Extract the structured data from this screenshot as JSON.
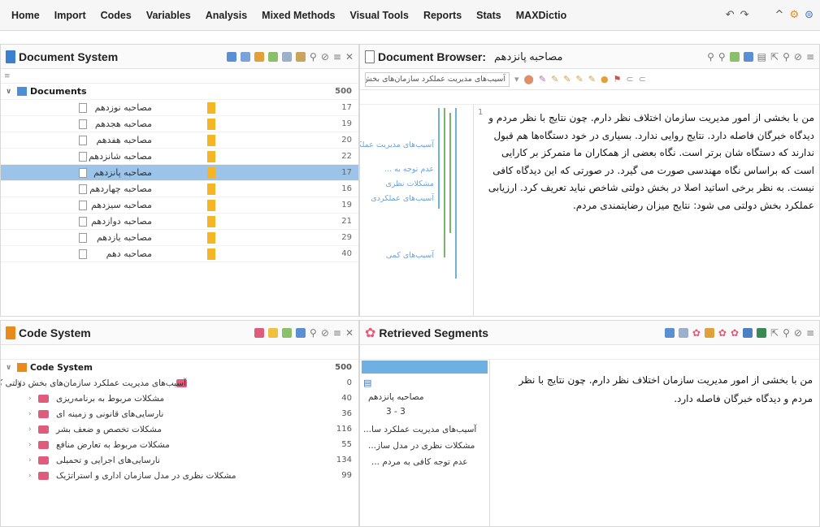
{
  "menu": [
    "Home",
    "Import",
    "Codes",
    "Variables",
    "Analysis",
    "Mixed Methods",
    "Visual Tools",
    "Reports",
    "Stats",
    "MAXDictio"
  ],
  "document_system": {
    "title": "Document System",
    "root": {
      "label": "Documents",
      "count": "500"
    },
    "documents": [
      {
        "name": "مصاحبه نوزدهم",
        "count": "17"
      },
      {
        "name": "مصاحبه هجدهم",
        "count": "19"
      },
      {
        "name": "مصاحبه هفدهم",
        "count": "20"
      },
      {
        "name": "مصاحبه شانزدهم",
        "count": "22"
      },
      {
        "name": "مصاحبه پانزدهم",
        "count": "17",
        "selected": true
      },
      {
        "name": "مصاحبه چهاردهم",
        "count": "16"
      },
      {
        "name": "مصاحبه سیزدهم",
        "count": "19"
      },
      {
        "name": "مصاحبه دوازدهم",
        "count": "21"
      },
      {
        "name": "مصاحبه یازدهم",
        "count": "29"
      },
      {
        "name": "مصاحبه دهم",
        "count": "40"
      }
    ]
  },
  "document_browser": {
    "title": "Document Browser:",
    "doc_name": "مصاحبه پانزدهم",
    "combo_value": "آسیب‌های مدیریت عملکرد سازمان‌های بخش دولتی کشور",
    "paragraph_number": "1",
    "strip_labels": [
      "آسیب‌های مدیریت عملکرد",
      "عدم توجه به ...",
      "مشکلات نظری",
      "آسیب‌های عملکردی",
      "آسیب‌های کمی"
    ],
    "text": "من با بخشی از امور مدیریت سازمان اختلاف نظر دارم. چون نتایج با نظر مردم و دیدگاه خبرگان فاصله دارد. نتایج روایی ندارد. بسیاری در خود دستگاه‌ها هم قبول ندارند که دستگاه شان برتر است. نگاه بعضی از همکاران ما متمرکز بر کارایی است که براساس نگاه مهندسی صورت می گیرد. در صورتی که این دیدگاه کافی نیست. به نظر برخی اساتید اصلا در بخش دولتی شاخص نباید تعریف کرد. ارزیابی عملکرد بخش دولتی می شود: نتایج میزان رضایتمندی مردم."
  },
  "code_system": {
    "title": "Code System",
    "root": {
      "label": "Code System",
      "count": "500"
    },
    "codes": [
      {
        "name": "آسیب‌های مدیریت عملکرد سازمان‌های بخش دولتی کشور",
        "count": "0",
        "level": 1
      },
      {
        "name": "مشکلات مربوط به برنامه‌ریزی",
        "count": "40",
        "level": 2
      },
      {
        "name": "نارسایی‌های قانونی و زمینه ای",
        "count": "36",
        "level": 2
      },
      {
        "name": "مشکلات تخصص و ضعف بشر",
        "count": "116",
        "level": 2
      },
      {
        "name": "مشکلات مربوط به تعارض منافع",
        "count": "55",
        "level": 2
      },
      {
        "name": "نارسایی‌های اجرایی و تحمیلی",
        "count": "134",
        "level": 2
      },
      {
        "name": "مشکلات نظری در مدل سازمان اداری و استراتژیک",
        "count": "99",
        "level": 2
      }
    ]
  },
  "retrieved_segments": {
    "title": "Retrieved Segments",
    "items": [
      "مصاحبه پانزدهم",
      "3 - 3",
      "آسیب‌های مدیریت عملکرد سا...",
      "مشکلات نظری در مدل ساز...",
      "عدم توجه کافی به مردم ..."
    ],
    "text": "من با بخشی از امور مدیریت سازمان اختلاف نظر دارم. چون نتایج با نظر مردم و دیدگاه خبرگان فاصله دارد."
  },
  "colors": {
    "selected_row": "#9cc3e8",
    "memo": "#f5b524",
    "code": "#e05c7c",
    "folder_docs": "#4c8fd6",
    "folder_codes": "#e98b1b"
  }
}
